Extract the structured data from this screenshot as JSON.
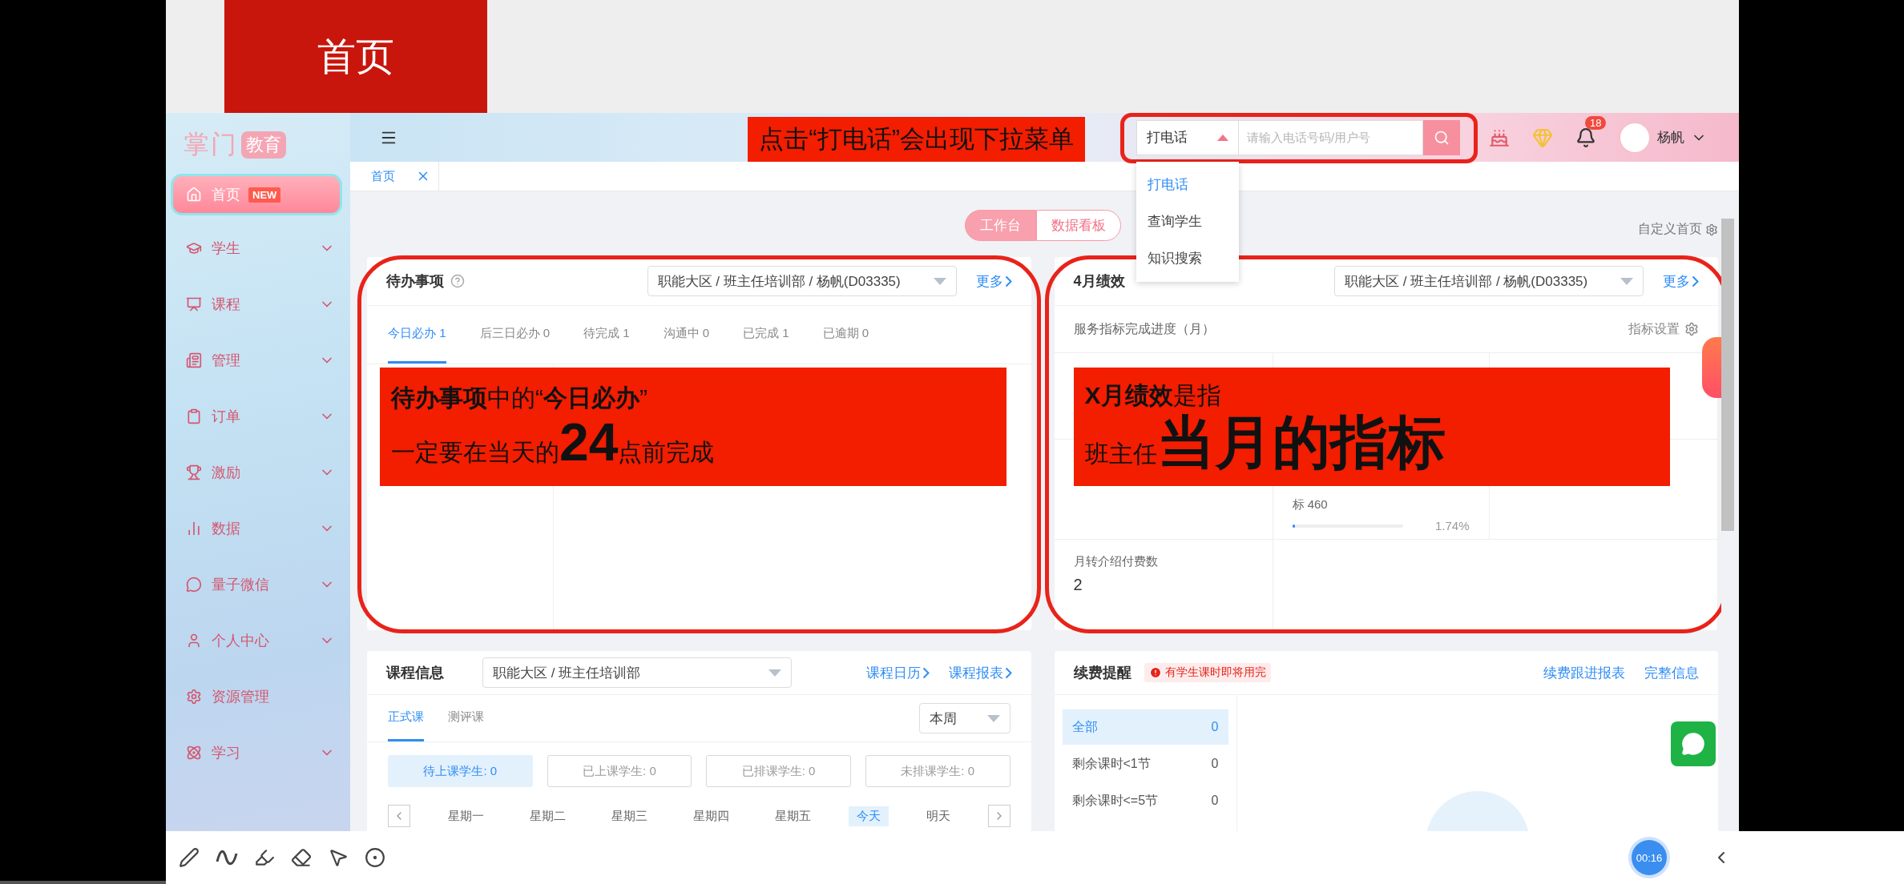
{
  "slide_title": "首页",
  "sidebar": {
    "logo": "掌门",
    "logo_badge": "教育",
    "items": [
      {
        "label": "首页",
        "selected": true,
        "expandable": false,
        "badge": "NEW"
      },
      {
        "label": "学生",
        "selected": false,
        "expandable": true
      },
      {
        "label": "课程",
        "selected": false,
        "expandable": true
      },
      {
        "label": "管理",
        "selected": false,
        "expandable": true
      },
      {
        "label": "订单",
        "selected": false,
        "expandable": true
      },
      {
        "label": "激励",
        "selected": false,
        "expandable": true
      },
      {
        "label": "数据",
        "selected": false,
        "expandable": true
      },
      {
        "label": "量子微信",
        "selected": false,
        "expandable": true
      },
      {
        "label": "个人中心",
        "selected": false,
        "expandable": true
      },
      {
        "label": "资源管理",
        "selected": false,
        "expandable": false
      },
      {
        "label": "学习",
        "selected": false,
        "expandable": true
      }
    ]
  },
  "header": {
    "annotation": "点击“打电话”会出现下拉菜单",
    "search": {
      "mode": "打电话",
      "placeholder": "请输入电话号码/用户号",
      "menu": [
        {
          "label": "打电话",
          "selected": true
        },
        {
          "label": "查询学生",
          "selected": false
        },
        {
          "label": "知识搜索",
          "selected": false
        }
      ]
    },
    "notification_count": "18",
    "user": "杨帆"
  },
  "tabs": [
    {
      "label": "首页",
      "selected": true
    }
  ],
  "view_toggle": [
    {
      "label": "工作台",
      "selected": true
    },
    {
      "label": "数据看板",
      "selected": false
    }
  ],
  "customize": "自定义首页",
  "todo_card": {
    "title": "待办事项",
    "scope": "职能大区 / 班主任培训部 / 杨帆(D03335)",
    "more": "更多",
    "tabs": [
      {
        "label": "今日必办 1",
        "selected": true
      },
      {
        "label": "后三日必办 0",
        "selected": false
      },
      {
        "label": "待完成 1",
        "selected": false
      },
      {
        "label": "沟通中 0",
        "selected": false
      },
      {
        "label": "已完成 1",
        "selected": false
      },
      {
        "label": "已逾期 0",
        "selected": false
      }
    ],
    "annotation": [
      "**待办事项**中的“**今日必办**”",
      "一定要在当天的**24**点前完成"
    ]
  },
  "perf_card": {
    "title": "4月绩效",
    "scope": "职能大区 / 班主任培训部 / 杨帆(D03335)",
    "more": "更多",
    "subtitle": "服务指标完成进度（月）",
    "settings": "指标设置",
    "metric": {
      "target": "标 460",
      "percent": "1.74%",
      "level": 0.0174
    },
    "referral": {
      "label": "月转介绍付费数",
      "value": "2"
    },
    "annotation": [
      "**X月绩效**是指",
      "班主任**当月的指标**"
    ]
  },
  "course_card": {
    "title": "课程信息",
    "scope": "职能大区 / 班主任培训部",
    "links": [
      "课程日历",
      "课程报表"
    ],
    "tabs": [
      {
        "label": "正式课",
        "selected": true
      },
      {
        "label": "测评课",
        "selected": false
      }
    ],
    "period": "本周",
    "student_filters": [
      {
        "label": "待上课学生: 0",
        "selected": true
      },
      {
        "label": "已上课学生: 0",
        "selected": false
      },
      {
        "label": "已排课学生: 0",
        "selected": false
      },
      {
        "label": "未排课学生: 0",
        "selected": false
      }
    ],
    "days": [
      {
        "label": "星期一",
        "selected": false
      },
      {
        "label": "星期二",
        "selected": false
      },
      {
        "label": "星期三",
        "selected": false
      },
      {
        "label": "星期四",
        "selected": false
      },
      {
        "label": "星期五",
        "selected": false
      },
      {
        "label": "今天",
        "selected": true
      },
      {
        "label": "明天",
        "selected": false
      }
    ]
  },
  "renewal_card": {
    "title": "续费提醒",
    "alert": "有学生课时即将用完",
    "links": [
      "续费跟进报表",
      "完整信息"
    ],
    "filters": [
      {
        "label": "全部",
        "count": "0",
        "selected": true
      },
      {
        "label": "剩余课时<1节",
        "count": "0",
        "selected": false
      },
      {
        "label": "剩余课时<=5节",
        "count": "0",
        "selected": false
      }
    ]
  },
  "timer": "00:16"
}
